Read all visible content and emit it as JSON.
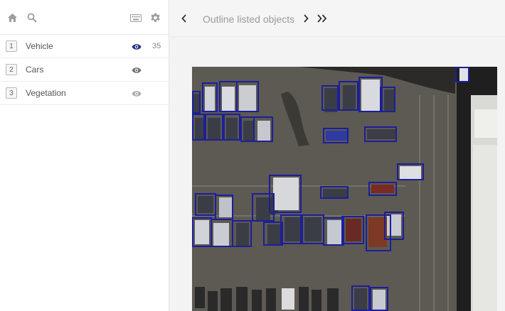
{
  "sidebar": {
    "icons": {
      "home": "home-icon",
      "search": "search-icon",
      "keyboard": "keyboard-icon",
      "settings": "gear-icon"
    },
    "items": [
      {
        "index": "1",
        "label": "Vehicle",
        "count": "35",
        "visible": true,
        "active": true
      },
      {
        "index": "2",
        "label": "Cars",
        "count": "",
        "visible": true,
        "active": false
      },
      {
        "index": "3",
        "label": "Vegetation",
        "count": "",
        "visible": true,
        "active": false
      }
    ]
  },
  "toolbar": {
    "title": "Outline listed objects",
    "prev_icon": "chevron-left-icon",
    "next_icon": "chevron-right-icon",
    "last_icon": "double-chevron-right-icon"
  },
  "canvas": {
    "box_color": "#1b1f9a",
    "ground_color": "#5b5751"
  }
}
